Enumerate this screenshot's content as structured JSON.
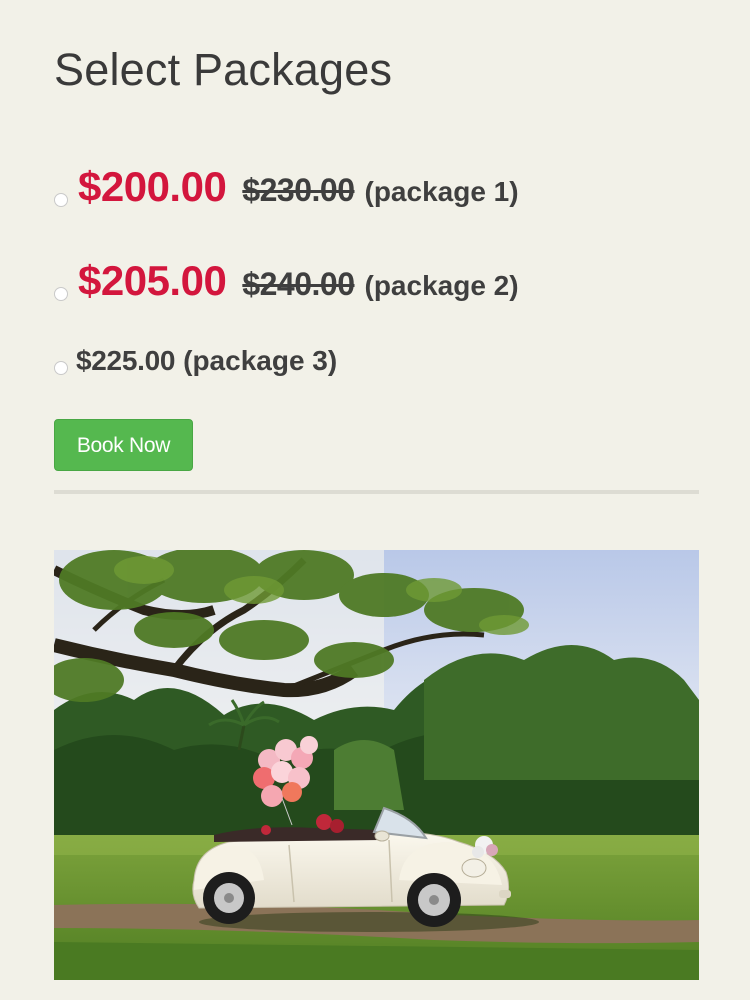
{
  "heading": "Select Packages",
  "packages": [
    {
      "sale_price": "$200.00",
      "regular_price": "$230.00",
      "label": "(package 1)"
    },
    {
      "sale_price": "$205.00",
      "regular_price": "$240.00",
      "label": "(package 2)"
    },
    {
      "price": "$225.00",
      "label": "(package 3)"
    }
  ],
  "book_button": "Book Now",
  "colors": {
    "background": "#f2f1e8",
    "sale_price": "#d3163d",
    "button": "#55b84f"
  }
}
